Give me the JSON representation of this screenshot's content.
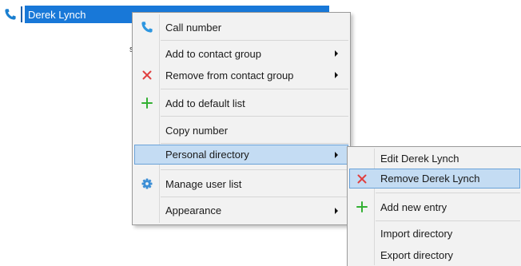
{
  "contact": {
    "name": "Derek Lynch",
    "icon": "phone-icon",
    "stray_char": "s"
  },
  "colors": {
    "selection_blue": "#1878d8",
    "menu_background": "#f2f2f2",
    "menu_highlight": "#c4dcf3",
    "menu_highlight_border": "#6aa2d8",
    "remove_red": "#e04040",
    "add_green": "#33b033",
    "gear_blue": "#3d8fd6",
    "phone_blue": "#1a7fd0"
  },
  "context_menu": {
    "items": [
      {
        "label": "Call number",
        "icon": "phone-icon",
        "has_submenu": false
      },
      {
        "label": "Add to contact group",
        "icon": "",
        "has_submenu": true
      },
      {
        "label": "Remove from contact group",
        "icon": "close-icon",
        "has_submenu": true
      },
      {
        "label": "Add to default list",
        "icon": "plus-icon",
        "has_submenu": false
      },
      {
        "label": "Copy number",
        "icon": "",
        "has_submenu": false
      },
      {
        "label": "Personal directory",
        "icon": "",
        "has_submenu": true,
        "highlighted": true
      },
      {
        "label": "Manage user list",
        "icon": "gear-icon",
        "has_submenu": false
      },
      {
        "label": "Appearance",
        "icon": "",
        "has_submenu": true
      }
    ]
  },
  "submenu": {
    "items": [
      {
        "label": "Edit Derek Lynch",
        "icon": ""
      },
      {
        "label": "Remove Derek Lynch",
        "icon": "close-icon",
        "highlighted": true
      },
      {
        "label": "Add new entry",
        "icon": "plus-icon"
      },
      {
        "label": "Import directory",
        "icon": ""
      },
      {
        "label": "Export directory",
        "icon": ""
      }
    ]
  }
}
